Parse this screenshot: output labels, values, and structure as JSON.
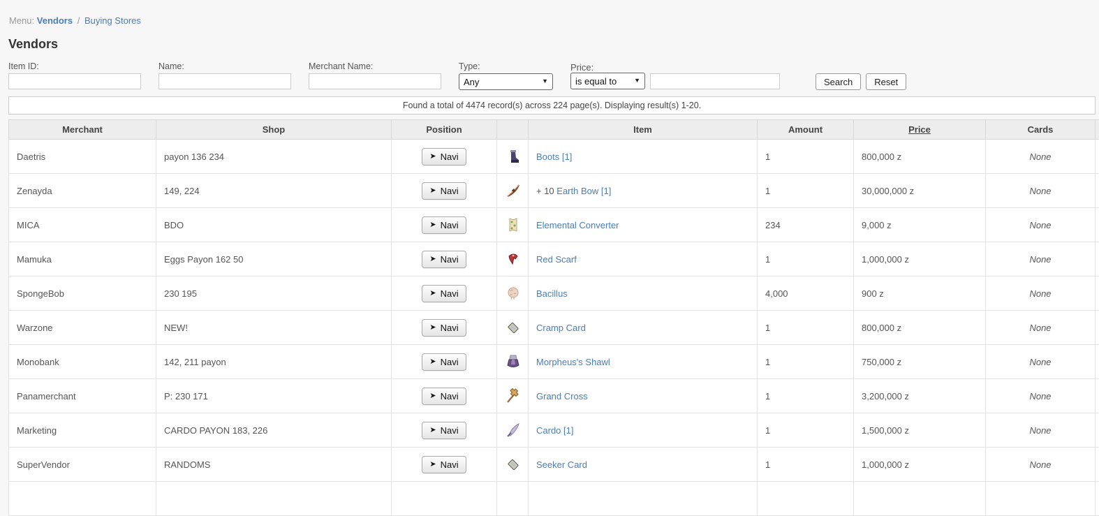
{
  "breadcrumb": {
    "prefix": "Menu:",
    "link_vendors": "Vendors",
    "separator": "/",
    "link_buying_stores": "Buying Stores"
  },
  "page": {
    "title": "Vendors"
  },
  "search_form": {
    "item_id": {
      "label": "Item ID:",
      "value": ""
    },
    "name": {
      "label": "Name:",
      "value": ""
    },
    "merchant_name": {
      "label": "Merchant Name:",
      "value": ""
    },
    "type": {
      "label": "Type:",
      "selected": "Any"
    },
    "price": {
      "label": "Price:",
      "operator_selected": "is equal to",
      "value": ""
    },
    "search_label": "Search",
    "reset_label": "Reset"
  },
  "results_summary": "Found a total of 4474 record(s) across 224 page(s). Displaying result(s) 1-20.",
  "icons": {
    "dropdown_arrow": "▼"
  },
  "colors": {
    "link": "#4a7db9",
    "page_background": "#f7f7f7",
    "header_background": "#ededed",
    "none_text": "#aaaaaa"
  },
  "table": {
    "headers": {
      "merchant": "Merchant",
      "shop": "Shop",
      "position": "Position",
      "icon": "",
      "item": "Item",
      "amount": "Amount",
      "price": "Price",
      "cards": "Cards",
      "stub": ""
    },
    "navi_icon": "➤",
    "navi_label": "Navi",
    "rows": [
      {
        "merchant": "Daetris",
        "shop": "payon 136 234",
        "icon": "boots-icon",
        "item_prefix": "",
        "item": "Boots [1]",
        "amount": "1",
        "price": "800,000 z",
        "cards": "None"
      },
      {
        "merchant": "Zenayda",
        "shop": "149, 224",
        "icon": "bow-icon",
        "item_prefix": "+ 10 ",
        "item": "Earth Bow [1]",
        "amount": "1",
        "price": "30,000,000 z",
        "cards": "None"
      },
      {
        "merchant": "MICA",
        "shop": "BDO",
        "icon": "scroll-icon",
        "item_prefix": "",
        "item": "Elemental Converter",
        "amount": "234",
        "price": "9,000 z",
        "cards": "None"
      },
      {
        "merchant": "Mamuka",
        "shop": "Eggs Payon 162 50",
        "icon": "scarf-icon",
        "item_prefix": "",
        "item": "Red Scarf",
        "amount": "1",
        "price": "1,000,000 z",
        "cards": "None"
      },
      {
        "merchant": "SpongeBob",
        "shop": "230 195",
        "icon": "bacillus-icon",
        "item_prefix": "",
        "item": "Bacillus",
        "amount": "4,000",
        "price": "900 z",
        "cards": "None"
      },
      {
        "merchant": "Warzone",
        "shop": "NEW!",
        "icon": "card-icon",
        "item_prefix": "",
        "item": "Cramp Card",
        "amount": "1",
        "price": "800,000 z",
        "cards": "None"
      },
      {
        "merchant": "Monobank",
        "shop": "142, 211 payon",
        "icon": "shawl-icon",
        "item_prefix": "",
        "item": "Morpheus's Shawl",
        "amount": "1",
        "price": "750,000 z",
        "cards": "None"
      },
      {
        "merchant": "Panamerchant",
        "shop": "P: 230 171",
        "icon": "cross-staff-icon",
        "item_prefix": "",
        "item": "Grand Cross",
        "amount": "1",
        "price": "3,200,000 z",
        "cards": "None"
      },
      {
        "merchant": "Marketing",
        "shop": "CARDO PAYON 183, 226",
        "icon": "lance-icon",
        "item_prefix": "",
        "item": "Cardo [1]",
        "amount": "1",
        "price": "1,500,000 z",
        "cards": "None"
      },
      {
        "merchant": "SuperVendor",
        "shop": "RANDOMS",
        "icon": "card-icon",
        "item_prefix": "",
        "item": "Seeker Card",
        "amount": "1",
        "price": "1,000,000 z",
        "cards": "None"
      }
    ]
  }
}
